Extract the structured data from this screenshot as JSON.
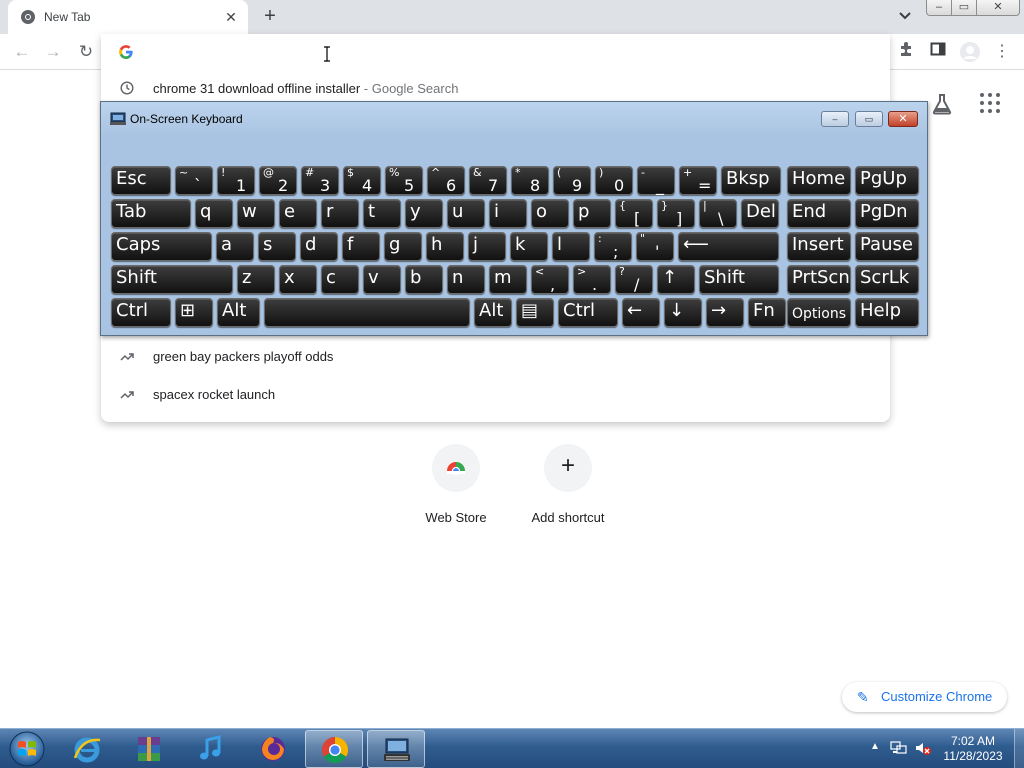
{
  "browser": {
    "tab_title": "New Tab",
    "tab_close": "✕",
    "new_tab": "+",
    "tab_search": "⌄",
    "window_controls": {
      "minimize": "–",
      "maximize": "▭",
      "close": "✕"
    },
    "nav": {
      "back": "←",
      "forward": "→",
      "reload": "↻"
    },
    "toolbar_icons": {
      "extensions": "extensions-icon",
      "side_panel": "side-panel-icon",
      "profile": "profile-icon",
      "menu": "⋮"
    }
  },
  "omnibox": {
    "value": "",
    "suggestions": [
      {
        "icon": "history-icon",
        "text": "chrome 31 download offline installer",
        "sub": " - Google Search"
      },
      {
        "icon": "trending-icon",
        "text": "green bay packers playoff odds",
        "sub": ""
      },
      {
        "icon": "trending-icon",
        "text": "spacex rocket launch",
        "sub": ""
      }
    ]
  },
  "osk": {
    "title": "On-Screen Keyboard",
    "rows": [
      [
        {
          "m": "Esc"
        },
        {
          "s": "~",
          "l": "`"
        },
        {
          "s": "!",
          "l": "1"
        },
        {
          "s": "@",
          "l": "2"
        },
        {
          "s": "#",
          "l": "3"
        },
        {
          "s": "$",
          "l": "4"
        },
        {
          "s": "%",
          "l": "5"
        },
        {
          "s": "^",
          "l": "6"
        },
        {
          "s": "&",
          "l": "7"
        },
        {
          "s": "*",
          "l": "8"
        },
        {
          "s": "(",
          "l": "9"
        },
        {
          "s": ")",
          "l": "0"
        },
        {
          "s": "-",
          "l": "_"
        },
        {
          "s": "+",
          "l": "="
        },
        {
          "m": "Bksp"
        },
        {
          "m": "Home"
        },
        {
          "m": "PgUp"
        }
      ],
      [
        {
          "m": "Tab"
        },
        {
          "m": "q"
        },
        {
          "m": "w"
        },
        {
          "m": "e"
        },
        {
          "m": "r"
        },
        {
          "m": "t"
        },
        {
          "m": "y"
        },
        {
          "m": "u"
        },
        {
          "m": "i"
        },
        {
          "m": "o"
        },
        {
          "m": "p"
        },
        {
          "s": "{",
          "l": "["
        },
        {
          "s": "}",
          "l": "]"
        },
        {
          "s": "|",
          "l": "\\"
        },
        {
          "m": "Del"
        },
        {
          "m": "End"
        },
        {
          "m": "PgDn"
        }
      ],
      [
        {
          "m": "Caps"
        },
        {
          "m": "a"
        },
        {
          "m": "s"
        },
        {
          "m": "d"
        },
        {
          "m": "f"
        },
        {
          "m": "g"
        },
        {
          "m": "h"
        },
        {
          "m": "j"
        },
        {
          "m": "k"
        },
        {
          "m": "l"
        },
        {
          "s": ":",
          "l": ";"
        },
        {
          "s": "\"",
          "l": "'"
        },
        {
          "m": "⟵"
        },
        {
          "m": "Insert"
        },
        {
          "m": "Pause"
        }
      ],
      [
        {
          "m": "Shift"
        },
        {
          "m": "z"
        },
        {
          "m": "x"
        },
        {
          "m": "c"
        },
        {
          "m": "v"
        },
        {
          "m": "b"
        },
        {
          "m": "n"
        },
        {
          "m": "m"
        },
        {
          "s": "<",
          "l": ","
        },
        {
          "s": ">",
          "l": "."
        },
        {
          "s": "?",
          "l": "/"
        },
        {
          "m": "↑"
        },
        {
          "m": "Shift"
        },
        {
          "m": "PrtScn"
        },
        {
          "m": "ScrLk"
        }
      ],
      [
        {
          "m": "Ctrl"
        },
        {
          "m": "⊞"
        },
        {
          "m": "Alt"
        },
        {
          "m": ""
        },
        {
          "m": "Alt"
        },
        {
          "m": "▤"
        },
        {
          "m": "Ctrl"
        },
        {
          "m": "←"
        },
        {
          "m": "↓"
        },
        {
          "m": "→"
        },
        {
          "m": "Fn"
        },
        {
          "m": "Options"
        },
        {
          "m": "Help"
        }
      ]
    ]
  },
  "ntp": {
    "shortcuts": [
      {
        "label": "Web Store"
      },
      {
        "label": "Add shortcut",
        "icon": "+"
      }
    ],
    "customize_label": "Customize Chrome",
    "customize_icon": "✎"
  },
  "taskbar": {
    "apps": [
      "internet-explorer",
      "winrar",
      "itunes",
      "firefox",
      "chrome",
      "on-screen-keyboard"
    ],
    "time": "7:02 AM",
    "date": "11/28/2023",
    "tray_up": "▲"
  }
}
